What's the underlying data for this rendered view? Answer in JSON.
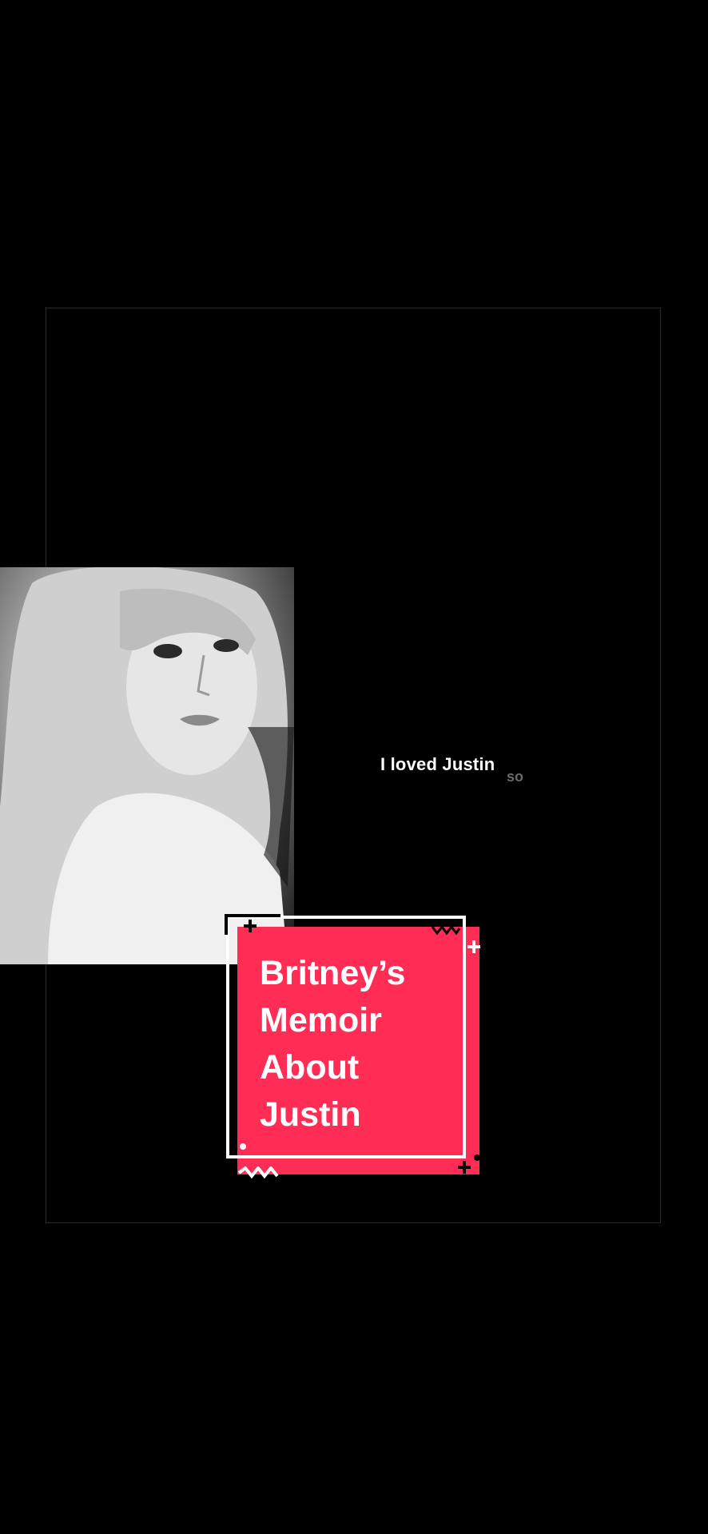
{
  "video": {
    "caption_text": "I loved Justin",
    "caption_next_word": "so",
    "title_card": {
      "title": "Britney’s\nMemoir\nAbout\nJustin",
      "accent_color": "#ff2d55"
    },
    "image": {
      "description_icon": "portrait-photo-icon"
    }
  }
}
